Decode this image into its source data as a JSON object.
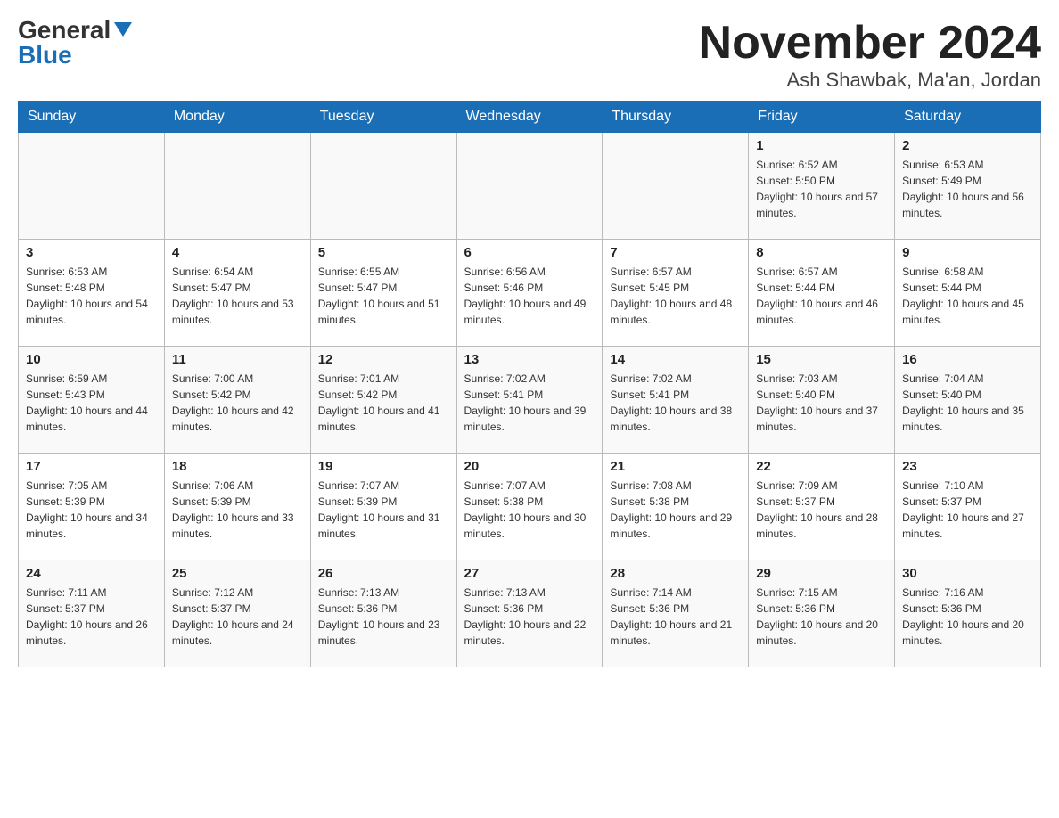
{
  "header": {
    "logo_general": "General",
    "logo_blue": "Blue",
    "month_title": "November 2024",
    "location": "Ash Shawbak, Ma'an, Jordan"
  },
  "days_of_week": [
    "Sunday",
    "Monday",
    "Tuesday",
    "Wednesday",
    "Thursday",
    "Friday",
    "Saturday"
  ],
  "weeks": [
    {
      "days": [
        {
          "number": "",
          "sunrise": "",
          "sunset": "",
          "daylight": ""
        },
        {
          "number": "",
          "sunrise": "",
          "sunset": "",
          "daylight": ""
        },
        {
          "number": "",
          "sunrise": "",
          "sunset": "",
          "daylight": ""
        },
        {
          "number": "",
          "sunrise": "",
          "sunset": "",
          "daylight": ""
        },
        {
          "number": "",
          "sunrise": "",
          "sunset": "",
          "daylight": ""
        },
        {
          "number": "1",
          "sunrise": "Sunrise: 6:52 AM",
          "sunset": "Sunset: 5:50 PM",
          "daylight": "Daylight: 10 hours and 57 minutes."
        },
        {
          "number": "2",
          "sunrise": "Sunrise: 6:53 AM",
          "sunset": "Sunset: 5:49 PM",
          "daylight": "Daylight: 10 hours and 56 minutes."
        }
      ]
    },
    {
      "days": [
        {
          "number": "3",
          "sunrise": "Sunrise: 6:53 AM",
          "sunset": "Sunset: 5:48 PM",
          "daylight": "Daylight: 10 hours and 54 minutes."
        },
        {
          "number": "4",
          "sunrise": "Sunrise: 6:54 AM",
          "sunset": "Sunset: 5:47 PM",
          "daylight": "Daylight: 10 hours and 53 minutes."
        },
        {
          "number": "5",
          "sunrise": "Sunrise: 6:55 AM",
          "sunset": "Sunset: 5:47 PM",
          "daylight": "Daylight: 10 hours and 51 minutes."
        },
        {
          "number": "6",
          "sunrise": "Sunrise: 6:56 AM",
          "sunset": "Sunset: 5:46 PM",
          "daylight": "Daylight: 10 hours and 49 minutes."
        },
        {
          "number": "7",
          "sunrise": "Sunrise: 6:57 AM",
          "sunset": "Sunset: 5:45 PM",
          "daylight": "Daylight: 10 hours and 48 minutes."
        },
        {
          "number": "8",
          "sunrise": "Sunrise: 6:57 AM",
          "sunset": "Sunset: 5:44 PM",
          "daylight": "Daylight: 10 hours and 46 minutes."
        },
        {
          "number": "9",
          "sunrise": "Sunrise: 6:58 AM",
          "sunset": "Sunset: 5:44 PM",
          "daylight": "Daylight: 10 hours and 45 minutes."
        }
      ]
    },
    {
      "days": [
        {
          "number": "10",
          "sunrise": "Sunrise: 6:59 AM",
          "sunset": "Sunset: 5:43 PM",
          "daylight": "Daylight: 10 hours and 44 minutes."
        },
        {
          "number": "11",
          "sunrise": "Sunrise: 7:00 AM",
          "sunset": "Sunset: 5:42 PM",
          "daylight": "Daylight: 10 hours and 42 minutes."
        },
        {
          "number": "12",
          "sunrise": "Sunrise: 7:01 AM",
          "sunset": "Sunset: 5:42 PM",
          "daylight": "Daylight: 10 hours and 41 minutes."
        },
        {
          "number": "13",
          "sunrise": "Sunrise: 7:02 AM",
          "sunset": "Sunset: 5:41 PM",
          "daylight": "Daylight: 10 hours and 39 minutes."
        },
        {
          "number": "14",
          "sunrise": "Sunrise: 7:02 AM",
          "sunset": "Sunset: 5:41 PM",
          "daylight": "Daylight: 10 hours and 38 minutes."
        },
        {
          "number": "15",
          "sunrise": "Sunrise: 7:03 AM",
          "sunset": "Sunset: 5:40 PM",
          "daylight": "Daylight: 10 hours and 37 minutes."
        },
        {
          "number": "16",
          "sunrise": "Sunrise: 7:04 AM",
          "sunset": "Sunset: 5:40 PM",
          "daylight": "Daylight: 10 hours and 35 minutes."
        }
      ]
    },
    {
      "days": [
        {
          "number": "17",
          "sunrise": "Sunrise: 7:05 AM",
          "sunset": "Sunset: 5:39 PM",
          "daylight": "Daylight: 10 hours and 34 minutes."
        },
        {
          "number": "18",
          "sunrise": "Sunrise: 7:06 AM",
          "sunset": "Sunset: 5:39 PM",
          "daylight": "Daylight: 10 hours and 33 minutes."
        },
        {
          "number": "19",
          "sunrise": "Sunrise: 7:07 AM",
          "sunset": "Sunset: 5:39 PM",
          "daylight": "Daylight: 10 hours and 31 minutes."
        },
        {
          "number": "20",
          "sunrise": "Sunrise: 7:07 AM",
          "sunset": "Sunset: 5:38 PM",
          "daylight": "Daylight: 10 hours and 30 minutes."
        },
        {
          "number": "21",
          "sunrise": "Sunrise: 7:08 AM",
          "sunset": "Sunset: 5:38 PM",
          "daylight": "Daylight: 10 hours and 29 minutes."
        },
        {
          "number": "22",
          "sunrise": "Sunrise: 7:09 AM",
          "sunset": "Sunset: 5:37 PM",
          "daylight": "Daylight: 10 hours and 28 minutes."
        },
        {
          "number": "23",
          "sunrise": "Sunrise: 7:10 AM",
          "sunset": "Sunset: 5:37 PM",
          "daylight": "Daylight: 10 hours and 27 minutes."
        }
      ]
    },
    {
      "days": [
        {
          "number": "24",
          "sunrise": "Sunrise: 7:11 AM",
          "sunset": "Sunset: 5:37 PM",
          "daylight": "Daylight: 10 hours and 26 minutes."
        },
        {
          "number": "25",
          "sunrise": "Sunrise: 7:12 AM",
          "sunset": "Sunset: 5:37 PM",
          "daylight": "Daylight: 10 hours and 24 minutes."
        },
        {
          "number": "26",
          "sunrise": "Sunrise: 7:13 AM",
          "sunset": "Sunset: 5:36 PM",
          "daylight": "Daylight: 10 hours and 23 minutes."
        },
        {
          "number": "27",
          "sunrise": "Sunrise: 7:13 AM",
          "sunset": "Sunset: 5:36 PM",
          "daylight": "Daylight: 10 hours and 22 minutes."
        },
        {
          "number": "28",
          "sunrise": "Sunrise: 7:14 AM",
          "sunset": "Sunset: 5:36 PM",
          "daylight": "Daylight: 10 hours and 21 minutes."
        },
        {
          "number": "29",
          "sunrise": "Sunrise: 7:15 AM",
          "sunset": "Sunset: 5:36 PM",
          "daylight": "Daylight: 10 hours and 20 minutes."
        },
        {
          "number": "30",
          "sunrise": "Sunrise: 7:16 AM",
          "sunset": "Sunset: 5:36 PM",
          "daylight": "Daylight: 10 hours and 20 minutes."
        }
      ]
    }
  ]
}
